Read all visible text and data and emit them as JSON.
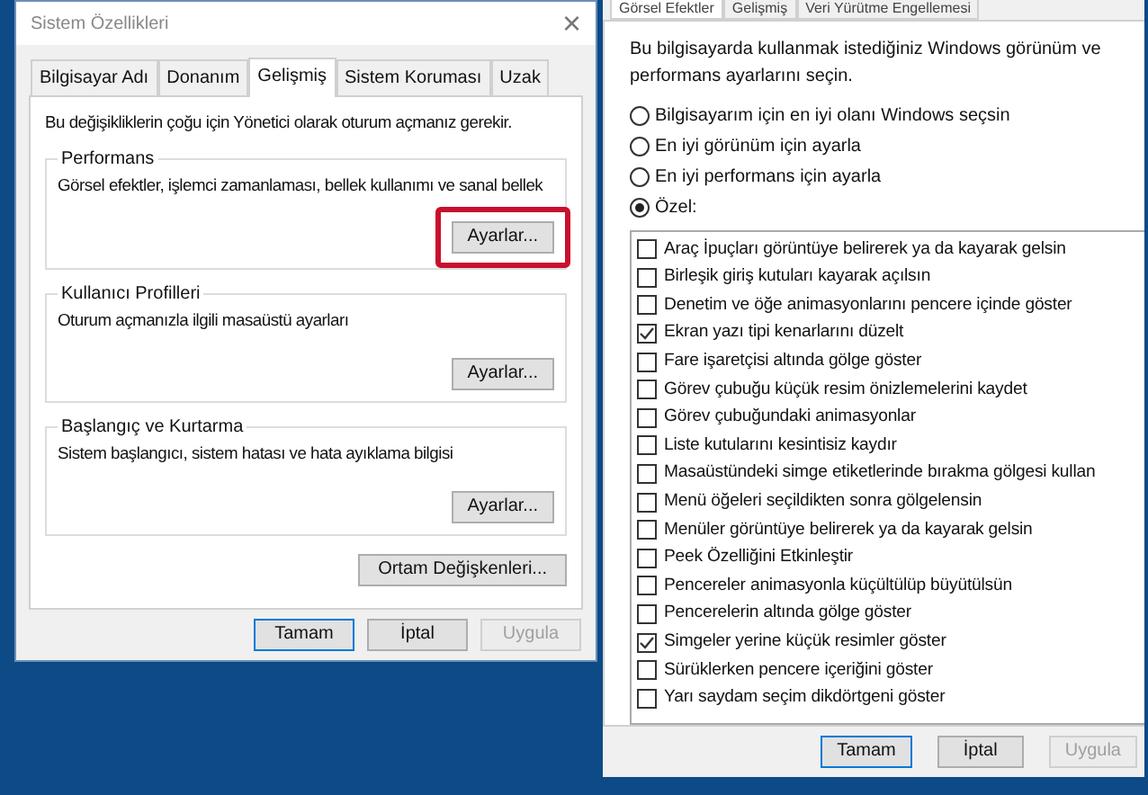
{
  "system_properties": {
    "title": "Sistem Özellikleri",
    "close": "×",
    "tabs": [
      {
        "label": "Bilgisayar Adı",
        "selected": false
      },
      {
        "label": "Donanım",
        "selected": false
      },
      {
        "label": "Gelişmiş",
        "selected": true
      },
      {
        "label": "Sistem Koruması",
        "selected": false
      },
      {
        "label": "Uzak",
        "selected": false
      }
    ],
    "notice": "Bu değişikliklerin çoğu için Yönetici olarak oturum açmanız gerekir.",
    "groups": [
      {
        "title": "Performans",
        "description": "Görsel efektler, işlemci zamanlaması, bellek kullanımı ve sanal bellek",
        "button": "Ayarlar...",
        "highlighted": true
      },
      {
        "title": "Kullanıcı Profilleri",
        "description": "Oturum açmanızla ilgili masaüstü ayarları",
        "button": "Ayarlar...",
        "highlighted": false
      },
      {
        "title": "Başlangıç ve Kurtarma",
        "description": "Sistem başlangıcı, sistem hatası ve hata ayıklama bilgisi",
        "button": "Ayarlar...",
        "highlighted": false
      }
    ],
    "env_button": "Ortam Değişkenleri...",
    "buttons": [
      {
        "label": "Tamam",
        "disabled": false
      },
      {
        "label": "İptal",
        "disabled": false
      },
      {
        "label": "Uygula",
        "disabled": true
      }
    ]
  },
  "performance_options": {
    "tabs": [
      {
        "label": "Görsel Efektler",
        "selected": true
      },
      {
        "label": "Gelişmiş",
        "selected": false
      },
      {
        "label": "Veri Yürütme Engellemesi",
        "selected": false
      }
    ],
    "intro": "Bu bilgisayarda kullanmak istediğiniz Windows görünüm ve performans ayarlarını seçin.",
    "radios": [
      {
        "label": "Bilgisayarım için en iyi olanı Windows seçsin",
        "selected": false
      },
      {
        "label": "En iyi görünüm için ayarla",
        "selected": false
      },
      {
        "label": "En iyi performans için ayarla",
        "selected": false
      },
      {
        "label": "Özel:",
        "selected": true
      }
    ],
    "effects": [
      {
        "label": "Araç İpuçları görüntüye belirerek ya da kayarak gelsin",
        "checked": false
      },
      {
        "label": "Birleşik giriş kutuları kayarak açılsın",
        "checked": false
      },
      {
        "label": "Denetim ve öğe animasyonlarını pencere içinde göster",
        "checked": false
      },
      {
        "label": "Ekran yazı tipi kenarlarını düzelt",
        "checked": true
      },
      {
        "label": "Fare işaretçisi altında gölge göster",
        "checked": false
      },
      {
        "label": "Görev çubuğu küçük resim önizlemelerini kaydet",
        "checked": false
      },
      {
        "label": "Görev çubuğundaki animasyonlar",
        "checked": false
      },
      {
        "label": "Liste kutularını kesintisiz kaydır",
        "checked": false
      },
      {
        "label": "Masaüstündeki simge etiketlerinde bırakma gölgesi kullan",
        "checked": false
      },
      {
        "label": "Menü öğeleri seçildikten sonra gölgelensin",
        "checked": false
      },
      {
        "label": "Menüler görüntüye belirerek ya da kayarak gelsin",
        "checked": false
      },
      {
        "label": "Peek Özelliğini Etkinleştir",
        "checked": false
      },
      {
        "label": "Pencereler animasyonla küçültülüp büyütülsün",
        "checked": false
      },
      {
        "label": "Pencerelerin altında gölge göster",
        "checked": false
      },
      {
        "label": "Simgeler yerine küçük resimler göster",
        "checked": true
      },
      {
        "label": "Sürüklerken pencere içeriğini göster",
        "checked": false
      },
      {
        "label": "Yarı saydam seçim dikdörtgeni göster",
        "checked": false
      }
    ],
    "buttons": [
      {
        "label": "Tamam",
        "disabled": false
      },
      {
        "label": "İptal",
        "disabled": false
      },
      {
        "label": "Uygula",
        "disabled": true
      }
    ]
  }
}
